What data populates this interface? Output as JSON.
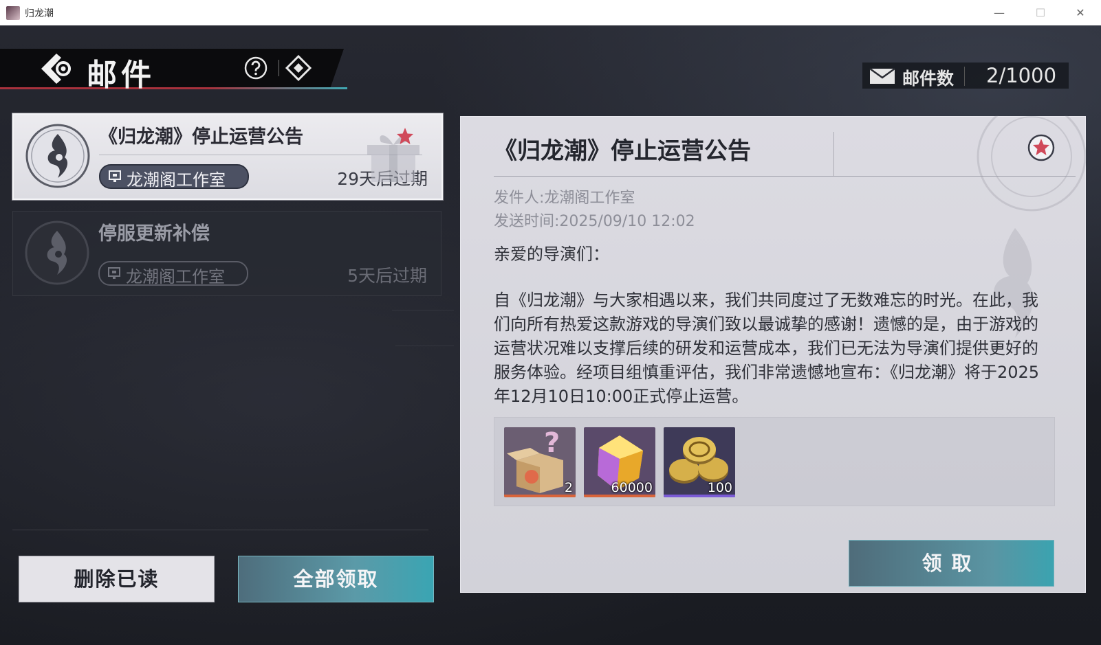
{
  "window": {
    "title": "归龙潮",
    "min_glyph": "—",
    "max_glyph": "☐",
    "close_glyph": "✕"
  },
  "header": {
    "title": "邮件"
  },
  "mail_count": {
    "label": "邮件数",
    "value": "2/1000"
  },
  "mails": [
    {
      "subject": "《归龙潮》停止运营公告",
      "sender": "龙潮阁工作室",
      "expiry": "29天后过期",
      "selected": true
    },
    {
      "subject": "停服更新补偿",
      "sender": "龙潮阁工作室",
      "expiry": "5天后过期",
      "selected": false
    }
  ],
  "buttons": {
    "delete_read": "删除已读",
    "claim_all": "全部领取",
    "claim": "领取"
  },
  "detail": {
    "title": "《归龙潮》停止运营公告",
    "sender_line": "发件人:龙潮阁工作室",
    "time_line": "发送时间:2025/09/10 12:02",
    "greeting": "亲爱的导演们：",
    "body": "自《归龙潮》与大家相遇以来，我们共同度过了无数难忘的时光。在此，我们向所有热爱这款游戏的导演们致以最诚挚的感谢！遗憾的是，由于游戏的运营状况难以支撑后续的研发和运营成本，我们已无法为导演们提供更好的服务体验。经项目组慎重评估，我们非常遗憾地宣布：《归龙潮》将于2025年12月10日10:00正式停止运营。",
    "attachments": [
      {
        "icon": "mystery-box-icon",
        "count": "2",
        "rarity_color": "#d9643a"
      },
      {
        "icon": "gem-icon",
        "count": "60000",
        "rarity_color": "#d9643a"
      },
      {
        "icon": "coins-icon",
        "count": "100",
        "rarity_color": "#7b5bd6"
      }
    ]
  },
  "colors": {
    "accent_teal": "#3ba3b0",
    "accent_red": "#a8323c",
    "panel": "#d6d6dd"
  }
}
